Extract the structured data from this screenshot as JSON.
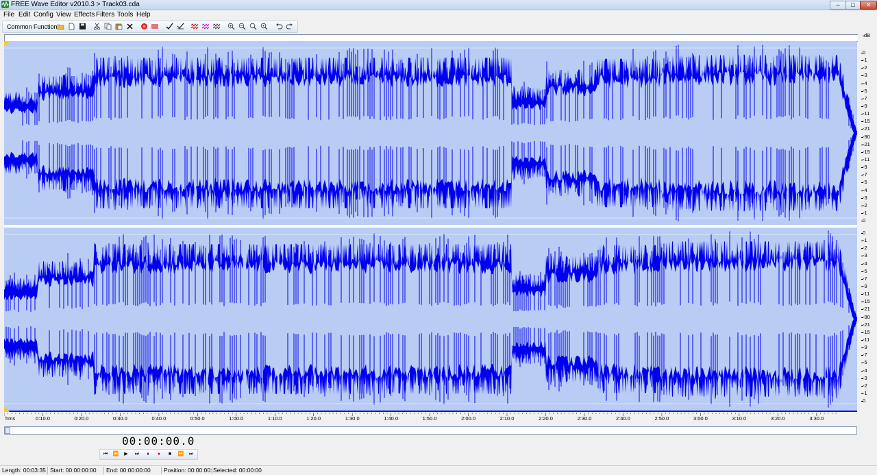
{
  "window": {
    "title": "FREE Wave Editor v2010.3 > Track03.cda",
    "controls": [
      "–",
      "□",
      "✕"
    ]
  },
  "menu": [
    "File",
    "Edit",
    "Config",
    "View",
    "Effects",
    "Filters",
    "Tools",
    "Help"
  ],
  "toolbar": {
    "label": "Common Functions:",
    "icons": [
      "open-icon",
      "new-icon",
      "save-icon",
      "cut-icon",
      "copy-icon",
      "paste-icon",
      "delete-icon",
      "record-icon",
      "trim-icon",
      "check-icon",
      "check-all-icon",
      "wave-icon",
      "wave-alt-icon",
      "wave-multi-icon",
      "zoom-in-icon",
      "zoom-out-icon",
      "zoom-fit-icon",
      "zoom-full-icon",
      "undo-icon",
      "redo-icon"
    ]
  },
  "db_scale": {
    "unit": "dB",
    "channel1": [
      "0",
      "-1",
      "-2",
      "-3",
      "-4",
      "-5",
      "-7",
      "-9",
      "-11",
      "-15",
      "-21",
      "-90",
      "-21",
      "-15",
      "-11",
      "-9",
      "-7",
      "-5",
      "-4",
      "-3",
      "-2",
      "-1",
      "0"
    ],
    "channel2": [
      "0",
      "-1",
      "-2",
      "-3",
      "-4",
      "-5",
      "-7",
      "-9",
      "-11",
      "-15",
      "-21",
      "-90",
      "-21",
      "-15",
      "-11",
      "-9",
      "-7",
      "-5",
      "-4",
      "-3",
      "-2",
      "-1",
      "0"
    ]
  },
  "time_ruler": {
    "unit_label": "hms",
    "labels": [
      "0:10.0",
      "0:20.0",
      "0:30.0",
      "0:40.0",
      "0:50.0",
      "1:00.0",
      "1:10.0",
      "1:20.0",
      "1:30.0",
      "1:40.0",
      "1:50.0",
      "2:00.0",
      "2:10.0",
      "2:20.0",
      "2:30.0",
      "2:40.0",
      "2:50.0",
      "3:00.0",
      "3:10.0",
      "3:20.0",
      "3:30.0"
    ],
    "total_seconds": 215
  },
  "transport": {
    "time": "00:00:00.0",
    "buttons": [
      "⏮",
      "⏪",
      "▶",
      "⏭",
      "⏸",
      "●",
      "■",
      "⏩",
      "⏭"
    ]
  },
  "status": {
    "length": "Length: 00:03:35",
    "start": "Start: 00:00:00:00",
    "end": "End: 00:00:00:00",
    "position": "Position: 00:00:00:00",
    "selected": "Selected: 00:00:00"
  },
  "colors": {
    "wave_fill": "#0000ee",
    "wave_bg": "#b8ccf4",
    "marker": "#ffd000"
  }
}
